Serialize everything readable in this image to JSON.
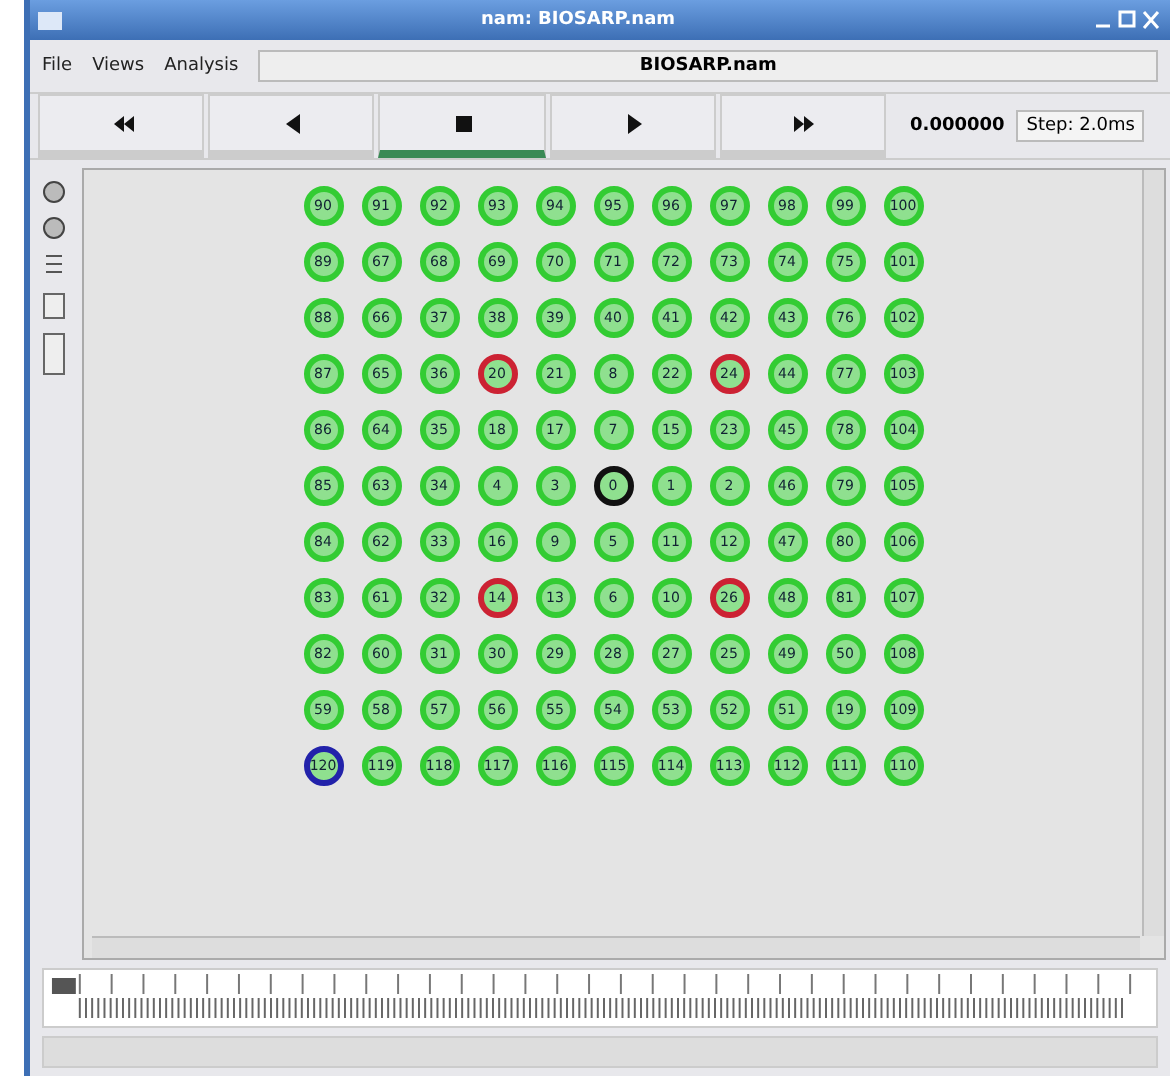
{
  "window": {
    "title": "nam: BIOSARP.nam"
  },
  "menu": [
    {
      "label": "File"
    },
    {
      "label": "Views"
    },
    {
      "label": "Analysis"
    }
  ],
  "file_field": {
    "value": "BIOSARP.nam"
  },
  "playback": [
    {
      "kind": "rewind",
      "selected": false
    },
    {
      "kind": "back",
      "selected": false
    },
    {
      "kind": "stop",
      "selected": true
    },
    {
      "kind": "play",
      "selected": false
    },
    {
      "kind": "forward",
      "selected": false
    }
  ],
  "time": "0.000000",
  "step": "Step: 2.0ms",
  "timeline": {
    "level": 0
  },
  "nodes": [
    [
      {
        "label": "90",
        "color": "#33cc33"
      },
      {
        "label": "91",
        "color": "#33cc33"
      },
      {
        "label": "92",
        "color": "#33cc33"
      },
      {
        "label": "93",
        "color": "#33cc33"
      },
      {
        "label": "94",
        "color": "#33cc33"
      },
      {
        "label": "95",
        "color": "#33cc33"
      },
      {
        "label": "96",
        "color": "#33cc33"
      },
      {
        "label": "97",
        "color": "#33cc33"
      },
      {
        "label": "98",
        "color": "#33cc33"
      },
      {
        "label": "99",
        "color": "#33cc33"
      },
      {
        "label": "100",
        "color": "#33cc33"
      }
    ],
    [
      {
        "label": "89",
        "color": "#33cc33"
      },
      {
        "label": "67",
        "color": "#33cc33"
      },
      {
        "label": "68",
        "color": "#33cc33"
      },
      {
        "label": "69",
        "color": "#33cc33"
      },
      {
        "label": "70",
        "color": "#33cc33"
      },
      {
        "label": "71",
        "color": "#33cc33"
      },
      {
        "label": "72",
        "color": "#33cc33"
      },
      {
        "label": "73",
        "color": "#33cc33"
      },
      {
        "label": "74",
        "color": "#33cc33"
      },
      {
        "label": "75",
        "color": "#33cc33"
      },
      {
        "label": "101",
        "color": "#33cc33"
      }
    ],
    [
      {
        "label": "88",
        "color": "#33cc33"
      },
      {
        "label": "66",
        "color": "#33cc33"
      },
      {
        "label": "37",
        "color": "#33cc33"
      },
      {
        "label": "38",
        "color": "#33cc33"
      },
      {
        "label": "39",
        "color": "#33cc33"
      },
      {
        "label": "40",
        "color": "#33cc33"
      },
      {
        "label": "41",
        "color": "#33cc33"
      },
      {
        "label": "42",
        "color": "#33cc33"
      },
      {
        "label": "43",
        "color": "#33cc33"
      },
      {
        "label": "76",
        "color": "#33cc33"
      },
      {
        "label": "102",
        "color": "#33cc33"
      }
    ],
    [
      {
        "label": "87",
        "color": "#33cc33"
      },
      {
        "label": "65",
        "color": "#33cc33"
      },
      {
        "label": "36",
        "color": "#33cc33"
      },
      {
        "label": "20",
        "color": "#cc2233"
      },
      {
        "label": "21",
        "color": "#33cc33"
      },
      {
        "label": "8",
        "color": "#33cc33"
      },
      {
        "label": "22",
        "color": "#33cc33"
      },
      {
        "label": "24",
        "color": "#cc2233"
      },
      {
        "label": "44",
        "color": "#33cc33"
      },
      {
        "label": "77",
        "color": "#33cc33"
      },
      {
        "label": "103",
        "color": "#33cc33"
      }
    ],
    [
      {
        "label": "86",
        "color": "#33cc33"
      },
      {
        "label": "64",
        "color": "#33cc33"
      },
      {
        "label": "35",
        "color": "#33cc33"
      },
      {
        "label": "18",
        "color": "#33cc33"
      },
      {
        "label": "17",
        "color": "#33cc33"
      },
      {
        "label": "7",
        "color": "#33cc33"
      },
      {
        "label": "15",
        "color": "#33cc33"
      },
      {
        "label": "23",
        "color": "#33cc33"
      },
      {
        "label": "45",
        "color": "#33cc33"
      },
      {
        "label": "78",
        "color": "#33cc33"
      },
      {
        "label": "104",
        "color": "#33cc33"
      }
    ],
    [
      {
        "label": "85",
        "color": "#33cc33"
      },
      {
        "label": "63",
        "color": "#33cc33"
      },
      {
        "label": "34",
        "color": "#33cc33"
      },
      {
        "label": "4",
        "color": "#33cc33"
      },
      {
        "label": "3",
        "color": "#33cc33"
      },
      {
        "label": "0",
        "color": "#111111"
      },
      {
        "label": "1",
        "color": "#33cc33"
      },
      {
        "label": "2",
        "color": "#33cc33"
      },
      {
        "label": "46",
        "color": "#33cc33"
      },
      {
        "label": "79",
        "color": "#33cc33"
      },
      {
        "label": "105",
        "color": "#33cc33"
      }
    ],
    [
      {
        "label": "84",
        "color": "#33cc33"
      },
      {
        "label": "62",
        "color": "#33cc33"
      },
      {
        "label": "33",
        "color": "#33cc33"
      },
      {
        "label": "16",
        "color": "#33cc33"
      },
      {
        "label": "9",
        "color": "#33cc33"
      },
      {
        "label": "5",
        "color": "#33cc33"
      },
      {
        "label": "11",
        "color": "#33cc33"
      },
      {
        "label": "12",
        "color": "#33cc33"
      },
      {
        "label": "47",
        "color": "#33cc33"
      },
      {
        "label": "80",
        "color": "#33cc33"
      },
      {
        "label": "106",
        "color": "#33cc33"
      }
    ],
    [
      {
        "label": "83",
        "color": "#33cc33"
      },
      {
        "label": "61",
        "color": "#33cc33"
      },
      {
        "label": "32",
        "color": "#33cc33"
      },
      {
        "label": "14",
        "color": "#cc2233"
      },
      {
        "label": "13",
        "color": "#33cc33"
      },
      {
        "label": "6",
        "color": "#33cc33"
      },
      {
        "label": "10",
        "color": "#33cc33"
      },
      {
        "label": "26",
        "color": "#cc2233"
      },
      {
        "label": "48",
        "color": "#33cc33"
      },
      {
        "label": "81",
        "color": "#33cc33"
      },
      {
        "label": "107",
        "color": "#33cc33"
      }
    ],
    [
      {
        "label": "82",
        "color": "#33cc33"
      },
      {
        "label": "60",
        "color": "#33cc33"
      },
      {
        "label": "31",
        "color": "#33cc33"
      },
      {
        "label": "30",
        "color": "#33cc33"
      },
      {
        "label": "29",
        "color": "#33cc33"
      },
      {
        "label": "28",
        "color": "#33cc33"
      },
      {
        "label": "27",
        "color": "#33cc33"
      },
      {
        "label": "25",
        "color": "#33cc33"
      },
      {
        "label": "49",
        "color": "#33cc33"
      },
      {
        "label": "50",
        "color": "#33cc33"
      },
      {
        "label": "108",
        "color": "#33cc33"
      }
    ],
    [
      {
        "label": "59",
        "color": "#33cc33"
      },
      {
        "label": "58",
        "color": "#33cc33"
      },
      {
        "label": "57",
        "color": "#33cc33"
      },
      {
        "label": "56",
        "color": "#33cc33"
      },
      {
        "label": "55",
        "color": "#33cc33"
      },
      {
        "label": "54",
        "color": "#33cc33"
      },
      {
        "label": "53",
        "color": "#33cc33"
      },
      {
        "label": "52",
        "color": "#33cc33"
      },
      {
        "label": "51",
        "color": "#33cc33"
      },
      {
        "label": "19",
        "color": "#33cc33"
      },
      {
        "label": "109",
        "color": "#33cc33"
      }
    ],
    [
      {
        "label": "120",
        "color": "#2222aa"
      },
      {
        "label": "119",
        "color": "#33cc33"
      },
      {
        "label": "118",
        "color": "#33cc33"
      },
      {
        "label": "117",
        "color": "#33cc33"
      },
      {
        "label": "116",
        "color": "#33cc33"
      },
      {
        "label": "115",
        "color": "#33cc33"
      },
      {
        "label": "114",
        "color": "#33cc33"
      },
      {
        "label": "113",
        "color": "#33cc33"
      },
      {
        "label": "112",
        "color": "#33cc33"
      },
      {
        "label": "111",
        "color": "#33cc33"
      },
      {
        "label": "110",
        "color": "#33cc33"
      }
    ]
  ]
}
